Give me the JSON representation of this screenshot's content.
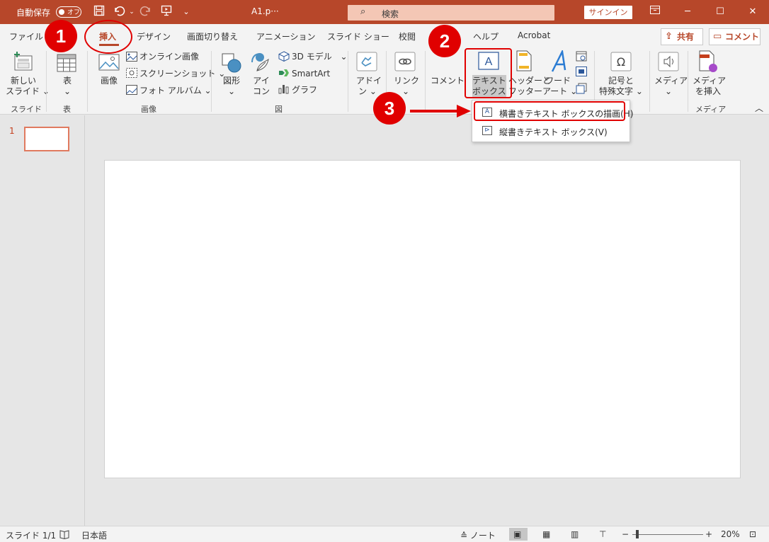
{
  "titlebar": {
    "autosave_label": "自動保存",
    "autosave_state": "オフ",
    "filename": "A1.p···",
    "search_placeholder": "検索",
    "signin_label": "サインイン"
  },
  "tabs": [
    "ファイル",
    "挿入",
    "デザイン",
    "画面切り替え",
    "アニメーション",
    "スライド ショー",
    "校閲",
    "表示",
    "ヘルプ",
    "Acrobat"
  ],
  "active_tab": "挿入",
  "ribbon_buttons": {
    "share": "共有",
    "comment": "コメント"
  },
  "ribbon": {
    "new_slide": [
      "新しい",
      "スライド"
    ],
    "table": "表",
    "image": "画像",
    "online_image": "オンライン画像",
    "screenshot": "スクリーンショット",
    "photo_album": "フォト アルバム",
    "shapes": "図形",
    "icons": [
      "アイ",
      "コン"
    ],
    "model3d": "3D モデル",
    "smartart": "SmartArt",
    "graph": "グラフ",
    "addin": [
      "アドイ",
      "ン"
    ],
    "link": "リンク",
    "comment": "コメント",
    "textbox": [
      "テキスト",
      "ボックス"
    ],
    "header_footer": [
      "ヘッダーと",
      "フッター"
    ],
    "wordart": [
      "ワード",
      "アート"
    ],
    "symbols": [
      "記号と",
      "特殊文字"
    ],
    "media": "メディア",
    "insert_media": [
      "メディア",
      "を挿入"
    ]
  },
  "groups": {
    "slide": "スライド",
    "table": "表",
    "image": "画像",
    "figure": "図",
    "media": "メディア"
  },
  "dropdown": {
    "items": [
      "横書きテキスト ボックスの描画(H)",
      "縦書きテキスト ボックス(V)"
    ]
  },
  "annotations": [
    "1",
    "2",
    "3"
  ],
  "accent_color": "#b7472a",
  "annotation_color": "#e00000",
  "sidebar": {
    "slide_number": "1"
  },
  "statusbar": {
    "slide_info": "スライド 1/1",
    "language": "日本語",
    "notes": "ノート",
    "zoom": "20%"
  }
}
